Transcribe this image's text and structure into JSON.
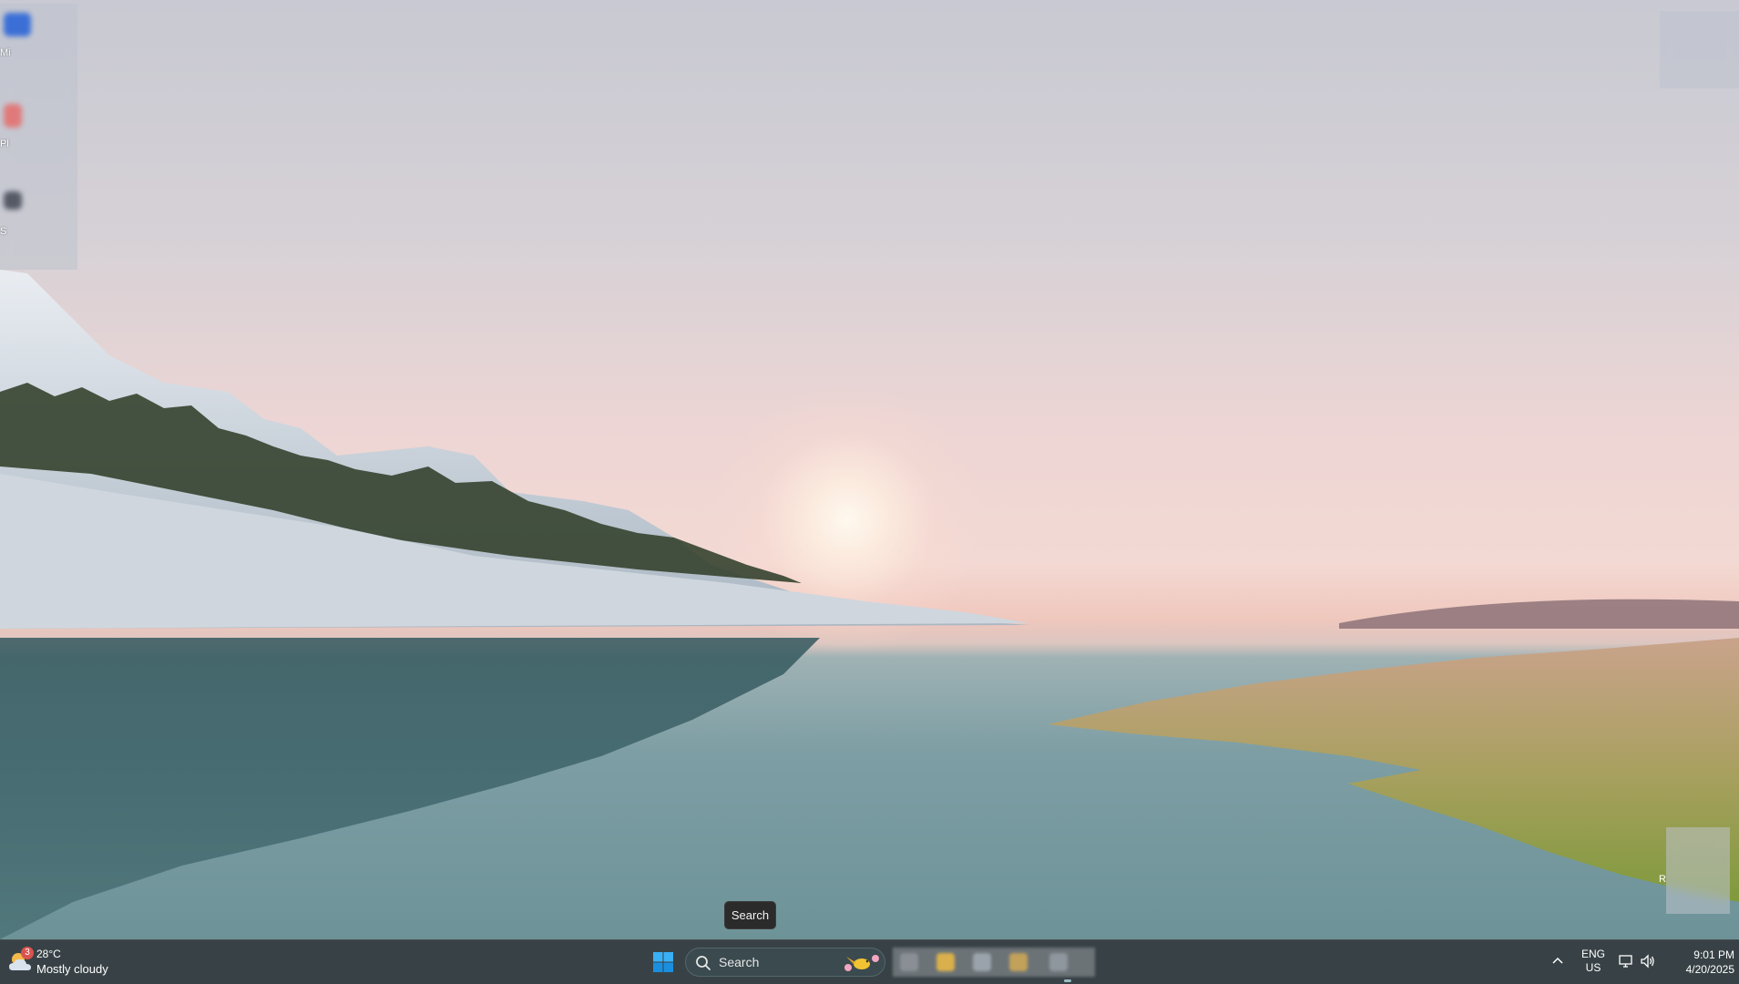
{
  "desktop": {
    "icon_captions": [
      "Mi",
      "Pl",
      "S",
      "R"
    ]
  },
  "tooltip": {
    "text": "Search"
  },
  "taskbar": {
    "weather": {
      "icon": "partly-cloudy-icon",
      "badge": "3",
      "temperature": "28°C",
      "condition": "Mostly cloudy"
    },
    "start_icon": "windows-logo-icon",
    "search": {
      "label": "Search",
      "icon": "search-icon",
      "highlight_icon": "bird-icon"
    },
    "tray": {
      "chevron_icon": "chevron-up-icon",
      "language_line1": "ENG",
      "language_line2": "US",
      "network_icon": "network-icon",
      "volume_icon": "volume-icon",
      "time": "9:01 PM",
      "date": "4/20/2025"
    }
  },
  "colors": {
    "taskbar_bg": "#1c282c",
    "accent": "#1da1f2",
    "badge": "#d9534f"
  }
}
